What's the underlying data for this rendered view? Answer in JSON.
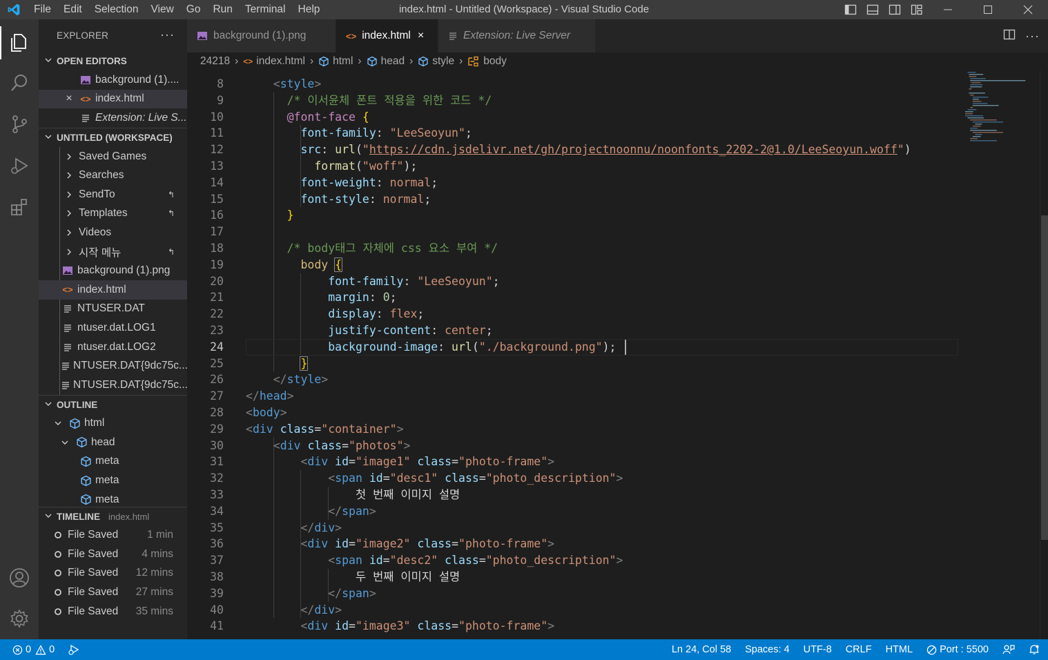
{
  "window": {
    "title": "index.html - Untitled (Workspace) - Visual Studio Code"
  },
  "menu": [
    "File",
    "Edit",
    "Selection",
    "View",
    "Go",
    "Run",
    "Terminal",
    "Help"
  ],
  "sidebar": {
    "title": "EXPLORER",
    "more": "···",
    "open_editors": {
      "header": "OPEN EDITORS",
      "items": [
        "background (1)....",
        "index.html",
        "Extension: Live S..."
      ]
    },
    "workspace": {
      "header": "UNTITLED (WORKSPACE)",
      "items": [
        {
          "label": "Saved Games",
          "kind": "folder"
        },
        {
          "label": "Searches",
          "kind": "folder"
        },
        {
          "label": "SendTo",
          "kind": "folder",
          "badge": "↰"
        },
        {
          "label": "Templates",
          "kind": "folder",
          "badge": "↰"
        },
        {
          "label": "Videos",
          "kind": "folder"
        },
        {
          "label": "시작 메뉴",
          "kind": "folder",
          "badge": "↰"
        },
        {
          "label": "background (1).png",
          "kind": "image"
        },
        {
          "label": "index.html",
          "kind": "html"
        },
        {
          "label": "NTUSER.DAT",
          "kind": "file"
        },
        {
          "label": "ntuser.dat.LOG1",
          "kind": "file"
        },
        {
          "label": "ntuser.dat.LOG2",
          "kind": "file"
        },
        {
          "label": "NTUSER.DAT{9dc75c...",
          "kind": "file"
        },
        {
          "label": "NTUSER.DAT{9dc75c...",
          "kind": "file"
        }
      ]
    },
    "outline": {
      "header": "OUTLINE",
      "items": [
        "html",
        "head",
        "meta",
        "meta",
        "meta"
      ]
    },
    "timeline": {
      "header": "TIMELINE",
      "file": "index.html",
      "items": [
        {
          "label": "File Saved",
          "time": "1 min"
        },
        {
          "label": "File Saved",
          "time": "4 mins"
        },
        {
          "label": "File Saved",
          "time": "12 mins"
        },
        {
          "label": "File Saved",
          "time": "27 mins"
        },
        {
          "label": "File Saved",
          "time": "35 mins"
        }
      ]
    }
  },
  "tabs": [
    {
      "label": "background (1).png",
      "active": false
    },
    {
      "label": "index.html",
      "active": true,
      "close": "×"
    },
    {
      "label": "Extension: Live Server",
      "active": false
    }
  ],
  "breadcrumbs": [
    "24218",
    "index.html",
    "html",
    "head",
    "style",
    "body"
  ],
  "editor": {
    "lines": [
      {
        "n": "8",
        "html": "    <span class='t-br'>&lt;</span><span class='t-tag'>style</span><span class='t-br'>&gt;</span>"
      },
      {
        "n": "9",
        "html": "      <span class='t-com'>/* 이서윤체 폰트 적용을 위한 코드 */</span>"
      },
      {
        "n": "10",
        "html": "      <span class='t-at'>@font-face</span> <span class='t-brace'>{</span>"
      },
      {
        "n": "11",
        "html": "        <span class='t-attr'>font-family</span>: <span class='t-str'>\"LeeSeoyun\"</span>;"
      },
      {
        "n": "12",
        "html": "        <span class='t-attr'>src</span>: <span class='t-fn'>url</span>(<span class='t-str'>\"</span><span class='t-link'>https://cdn.jsdelivr.net/gh/projectnoonnu/noonfonts_2202-2@1.0/LeeSeoyun.woff</span><span class='t-str'>\"</span>)"
      },
      {
        "n": "13",
        "html": "          <span class='t-fn'>format</span>(<span class='t-str'>\"woff\"</span>);"
      },
      {
        "n": "14",
        "html": "        <span class='t-attr'>font-weight</span>: <span class='t-str'>normal</span>;"
      },
      {
        "n": "15",
        "html": "        <span class='t-attr'>font-style</span>: <span class='t-str'>normal</span>;"
      },
      {
        "n": "16",
        "html": "      <span class='t-brace'>}</span>"
      },
      {
        "n": "17",
        "html": ""
      },
      {
        "n": "18",
        "html": "      <span class='t-com'>/* body태그 자체에 css 요소 부여 */</span>"
      },
      {
        "n": "19",
        "html": "        <span class='t-sel'>body</span> <span class='t-brace brmatch'>{</span>"
      },
      {
        "n": "20",
        "html": "            <span class='t-attr'>font-family</span>: <span class='t-str'>\"LeeSeoyun\"</span>;"
      },
      {
        "n": "21",
        "html": "            <span class='t-attr'>margin</span>: <span class='t-num'>0</span>;"
      },
      {
        "n": "22",
        "html": "            <span class='t-attr'>display</span>: <span class='t-str'>flex</span>;"
      },
      {
        "n": "23",
        "html": "            <span class='t-attr'>justify-content</span>: <span class='t-str'>center</span>;"
      },
      {
        "n": "24",
        "html": "            <span class='t-attr'>background-image</span>: <span class='t-fn'>url</span>(<span class='t-str'>\"./background.png\"</span>);",
        "current": true
      },
      {
        "n": "25",
        "html": "        <span class='t-brace brmatch'>}</span>"
      },
      {
        "n": "26",
        "html": "    <span class='t-br'>&lt;/</span><span class='t-tag'>style</span><span class='t-br'>&gt;</span>"
      },
      {
        "n": "27",
        "html": "<span class='t-br'>&lt;/</span><span class='t-tag'>head</span><span class='t-br'>&gt;</span>"
      },
      {
        "n": "28",
        "html": "<span class='t-br'>&lt;</span><span class='t-tag'>body</span><span class='t-br'>&gt;</span>"
      },
      {
        "n": "29",
        "html": "<span class='t-br'>&lt;</span><span class='t-tag'>div</span> <span class='t-attr'>class</span>=<span class='t-str'>\"container\"</span><span class='t-br'>&gt;</span>"
      },
      {
        "n": "30",
        "html": "    <span class='t-br'>&lt;</span><span class='t-tag'>div</span> <span class='t-attr'>class</span>=<span class='t-str'>\"photos\"</span><span class='t-br'>&gt;</span>"
      },
      {
        "n": "31",
        "html": "        <span class='t-br'>&lt;</span><span class='t-tag'>div</span> <span class='t-attr'>id</span>=<span class='t-str'>\"image1\"</span> <span class='t-attr'>class</span>=<span class='t-str'>\"photo-frame\"</span><span class='t-br'>&gt;</span>"
      },
      {
        "n": "32",
        "html": "            <span class='t-br'>&lt;</span><span class='t-tag'>span</span> <span class='t-attr'>id</span>=<span class='t-str'>\"desc1\"</span> <span class='t-attr'>class</span>=<span class='t-str'>\"photo_description\"</span><span class='t-br'>&gt;</span>"
      },
      {
        "n": "33",
        "html": "                <span class='t-txt'>첫 번째 이미지 설명</span>"
      },
      {
        "n": "34",
        "html": "            <span class='t-br'>&lt;/</span><span class='t-tag'>span</span><span class='t-br'>&gt;</span>"
      },
      {
        "n": "35",
        "html": "        <span class='t-br'>&lt;/</span><span class='t-tag'>div</span><span class='t-br'>&gt;</span>"
      },
      {
        "n": "36",
        "html": "        <span class='t-br'>&lt;</span><span class='t-tag'>div</span> <span class='t-attr'>id</span>=<span class='t-str'>\"image2\"</span> <span class='t-attr'>class</span>=<span class='t-str'>\"photo-frame\"</span><span class='t-br'>&gt;</span>"
      },
      {
        "n": "37",
        "html": "            <span class='t-br'>&lt;</span><span class='t-tag'>span</span> <span class='t-attr'>id</span>=<span class='t-str'>\"desc2\"</span> <span class='t-attr'>class</span>=<span class='t-str'>\"photo_description\"</span><span class='t-br'>&gt;</span>"
      },
      {
        "n": "38",
        "html": "                <span class='t-txt'>두 번째 이미지 설명</span>"
      },
      {
        "n": "39",
        "html": "            <span class='t-br'>&lt;/</span><span class='t-tag'>span</span><span class='t-br'>&gt;</span>"
      },
      {
        "n": "40",
        "html": "        <span class='t-br'>&lt;/</span><span class='t-tag'>div</span><span class='t-br'>&gt;</span>"
      },
      {
        "n": "41",
        "html": "        <span class='t-br'>&lt;</span><span class='t-tag'>div</span> <span class='t-attr'>id</span>=<span class='t-str'>\"image3\"</span> <span class='t-attr'>class</span>=<span class='t-str'>\"photo-frame\"</span><span class='t-br'>&gt;</span>"
      }
    ]
  },
  "status": {
    "errors": "0",
    "warnings": "0",
    "position": "Ln 24, Col 58",
    "spaces": "Spaces: 4",
    "encoding": "UTF-8",
    "eol": "CRLF",
    "language": "HTML",
    "port": "Port : 5500"
  },
  "colors": {
    "statusbar": "#007acc",
    "titlebar": "#3c3c3c",
    "sidebar": "#252526",
    "editor": "#1e1e1e",
    "activitybar": "#333333"
  }
}
